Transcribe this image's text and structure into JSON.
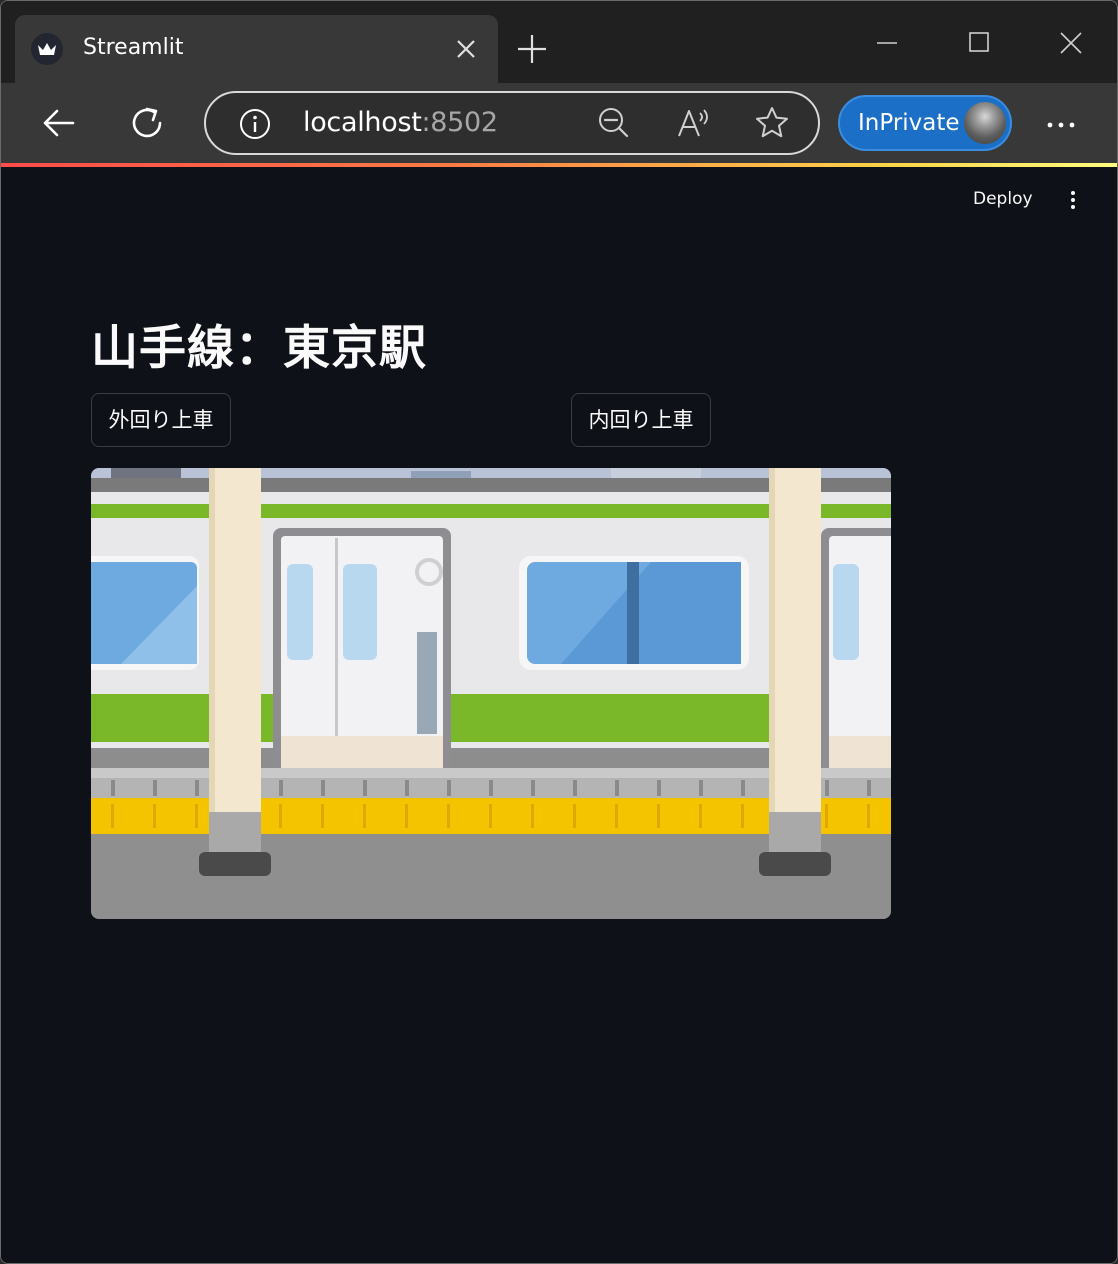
{
  "browser": {
    "tab_title": "Streamlit",
    "url_host": "localhost",
    "url_port": ":8502",
    "inprivate_label": "InPrivate"
  },
  "app": {
    "deploy_label": "Deploy",
    "title": "山手線：東京駅",
    "buttons": {
      "outer_loop": "外回り上車",
      "inner_loop": "内回り上車"
    },
    "image": {
      "subject": "yamanote-line-train-at-platform"
    }
  },
  "colors": {
    "app_background": "#0e1117",
    "train_green": "#7ab829",
    "platform_yellow": "#f5c400",
    "inprivate_blue": "#1b6fc6"
  }
}
